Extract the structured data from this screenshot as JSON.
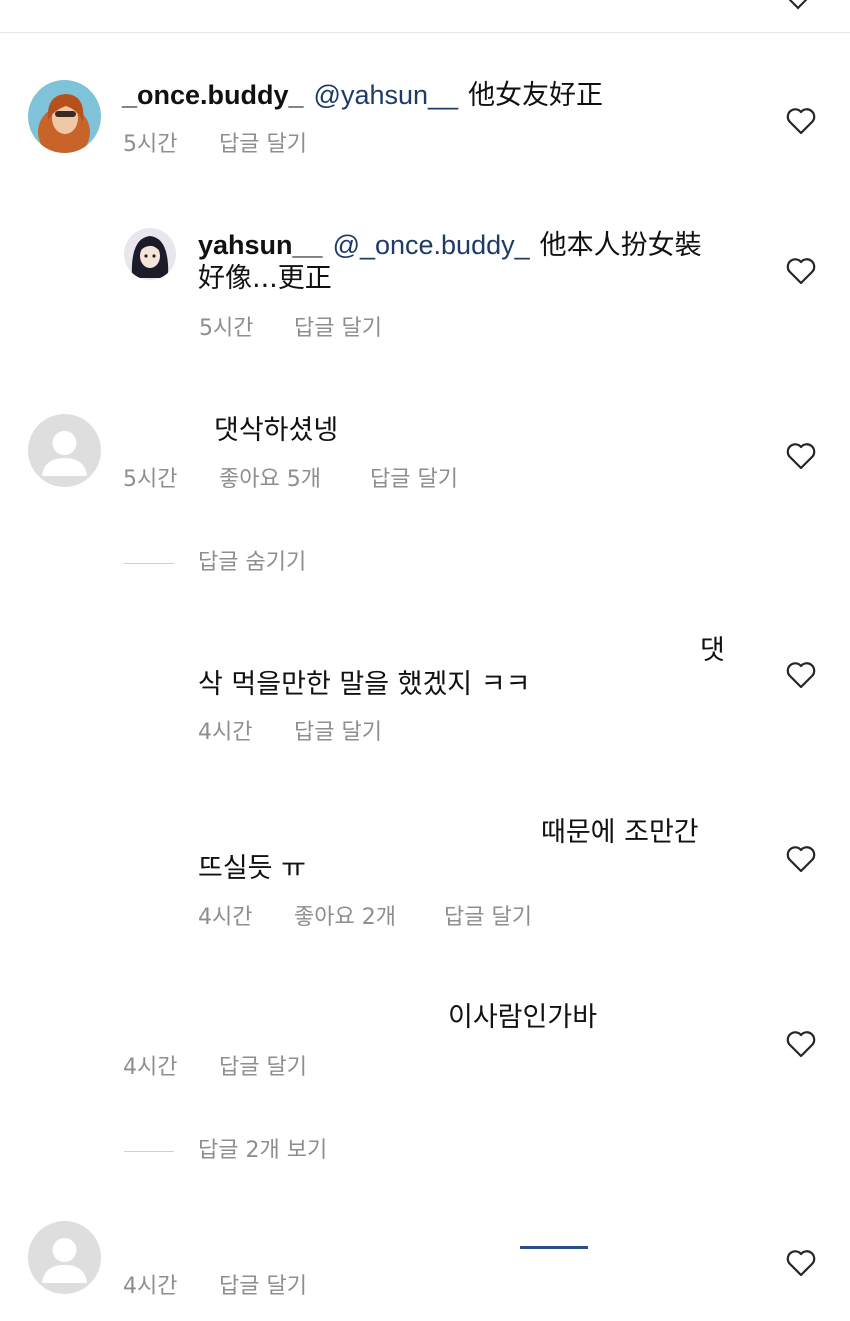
{
  "comments": [
    {
      "username": "_once.buddy_",
      "mention": "@yahsun__",
      "text": "他女友好正",
      "time": "5시간",
      "reply": "답글 달기"
    },
    {
      "username": "yahsun__",
      "mention": "@_once.buddy_",
      "text_line1": "他本人扮女裝",
      "text_line2": "好像...更正",
      "time": "5시간",
      "reply": "답글 달기"
    },
    {
      "text": "댓삭하셨넹",
      "time": "5시간",
      "likes": "좋아요 5개",
      "reply": "답글 달기",
      "thread_toggle": "답글 숨기기"
    },
    {
      "text_line1_end": "댓",
      "text_line2": "삭 먹을만한 말을 했겠지 ㅋㅋ",
      "time": "4시간",
      "reply": "답글 달기"
    },
    {
      "text_line1_end": "때문에 조만간",
      "text_line2": "뜨실듯 ㅠ",
      "time": "4시간",
      "likes": "좋아요 2개",
      "reply": "답글 달기"
    },
    {
      "text_line1_end": "이사람인가바",
      "time": "4시간",
      "reply": "답글 달기",
      "thread_toggle": "답글 2개 보기"
    },
    {
      "time": "4시간",
      "reply": "답글 달기"
    }
  ],
  "icons": {
    "like": "heart-outline-icon",
    "collapse": "chevron-down-icon"
  },
  "colors": {
    "mention": "#1e3a66",
    "meta": "#8e8e8e"
  }
}
